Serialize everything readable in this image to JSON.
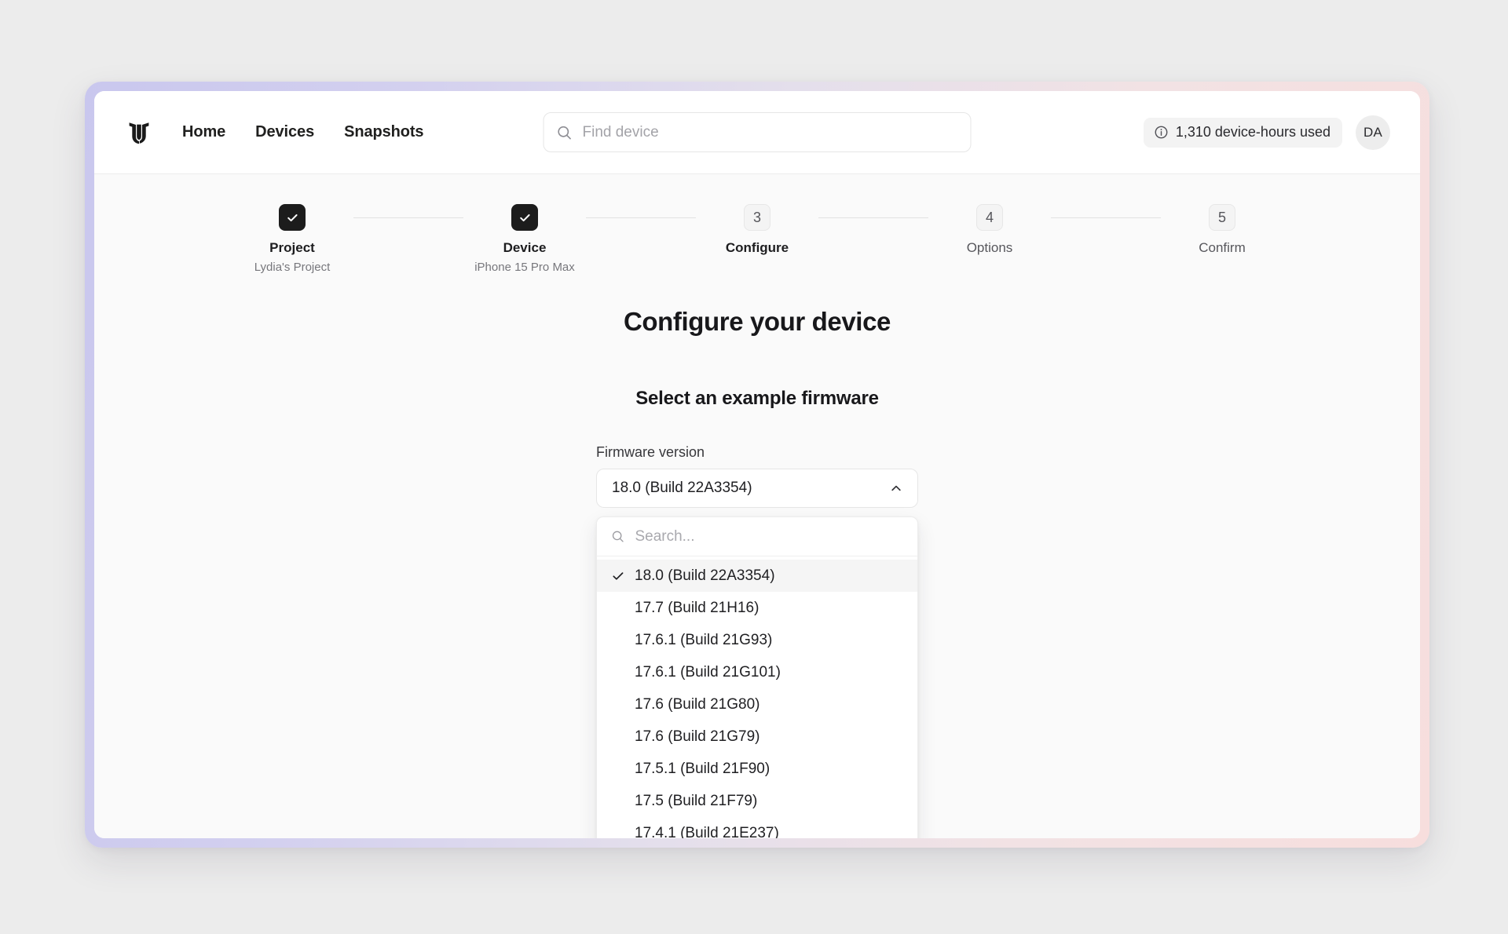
{
  "nav": {
    "logo_icon": "corellium-logo-icon",
    "links": [
      {
        "label": "Home"
      },
      {
        "label": "Devices"
      },
      {
        "label": "Snapshots"
      }
    ],
    "search": {
      "icon": "search-icon",
      "placeholder": "Find device",
      "value": ""
    },
    "usage_badge": {
      "icon": "info-circle-icon",
      "label": "1,310 device-hours used"
    },
    "avatar": {
      "initials": "DA"
    }
  },
  "stepper": {
    "steps": [
      {
        "number": "1",
        "state": "done",
        "icon": "check-icon",
        "label": "Project",
        "sub": "Lydia's Project"
      },
      {
        "number": "2",
        "state": "done",
        "icon": "check-icon",
        "label": "Device",
        "sub": "iPhone 15 Pro Max"
      },
      {
        "number": "3",
        "state": "active",
        "label": "Configure",
        "sub": ""
      },
      {
        "number": "4",
        "state": "todo",
        "label": "Options",
        "sub": ""
      },
      {
        "number": "5",
        "state": "todo",
        "label": "Confirm",
        "sub": ""
      }
    ]
  },
  "main": {
    "page_title": "Configure your device",
    "section_title": "Select an example firmware",
    "field": {
      "label": "Firmware version",
      "selected_value": "18.0 (Build 22A3354)",
      "chevron_icon": "chevron-up-icon"
    },
    "dropdown": {
      "open": true,
      "search": {
        "icon": "search-icon",
        "placeholder": "Search...",
        "value": ""
      },
      "check_icon": "check-icon",
      "options": [
        {
          "label": "18.0 (Build 22A3354)",
          "selected": true
        },
        {
          "label": "17.7 (Build 21H16)",
          "selected": false
        },
        {
          "label": "17.6.1 (Build 21G93)",
          "selected": false
        },
        {
          "label": "17.6.1 (Build 21G101)",
          "selected": false
        },
        {
          "label": "17.6 (Build 21G80)",
          "selected": false
        },
        {
          "label": "17.6 (Build 21G79)",
          "selected": false
        },
        {
          "label": "17.5.1 (Build 21F90)",
          "selected": false
        },
        {
          "label": "17.5 (Build 21F79)",
          "selected": false
        },
        {
          "label": "17.4.1 (Build 21E237)",
          "selected": false
        }
      ]
    }
  },
  "colors": {
    "page_bg": "#ececec",
    "frame_gradient_start": "#c9c7ee",
    "frame_gradient_end": "#f7dedd",
    "app_bg": "#fafafa",
    "accent_dark": "#1c1c1c",
    "selected_row": "#f5f5f5"
  }
}
